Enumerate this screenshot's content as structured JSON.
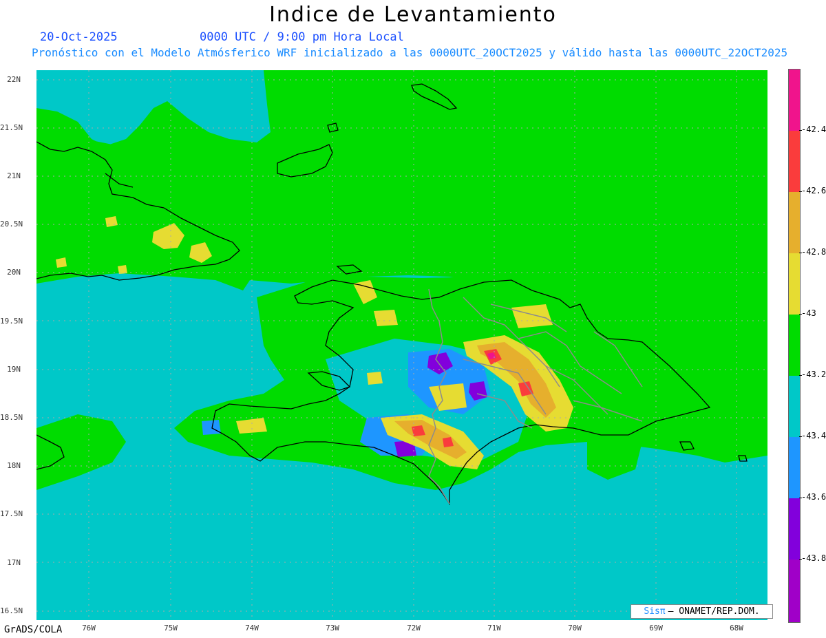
{
  "header": {
    "title": "Indice de Levantamiento",
    "date": "20-Oct-2025",
    "time": "0000 UTC / 9:00 pm Hora Local",
    "description": "Pronóstico con el Modelo Atmósferico WRF inicializado a las 0000UTC_20OCT2025 y válido hasta las  0000UTC_22OCT2025"
  },
  "map": {
    "lat_labels": [
      "22N",
      "21.5N",
      "21N",
      "20.5N",
      "20N",
      "19.5N",
      "19N",
      "18.5N",
      "18N",
      "17.5N",
      "17N",
      "16.5N"
    ],
    "lon_labels": [
      "76W",
      "75W",
      "74W",
      "73W",
      "72W",
      "71W",
      "70W",
      "69W",
      "68W"
    ],
    "colors": {
      "ocean_base": "#00c8c8",
      "green_zone": "#00dc00",
      "coastline": "#000000",
      "border": "#8c8c8c"
    }
  },
  "colorbar": {
    "levels": [
      "-42.4",
      "-42.6",
      "-42.8",
      "-43",
      "-43.2",
      "-43.4",
      "-43.6",
      "-43.8"
    ],
    "colors": [
      "#f0148c",
      "#fa3c3c",
      "#e6af2d",
      "#e6dc32",
      "#00dc00",
      "#00c8c8",
      "#1e96ff",
      "#8200dc",
      "#a000c8"
    ]
  },
  "credit": {
    "sis": "Sisπ",
    "org": "– ONAMET/REP.DOM."
  },
  "footer": {
    "software": "GrADS/COLA"
  }
}
